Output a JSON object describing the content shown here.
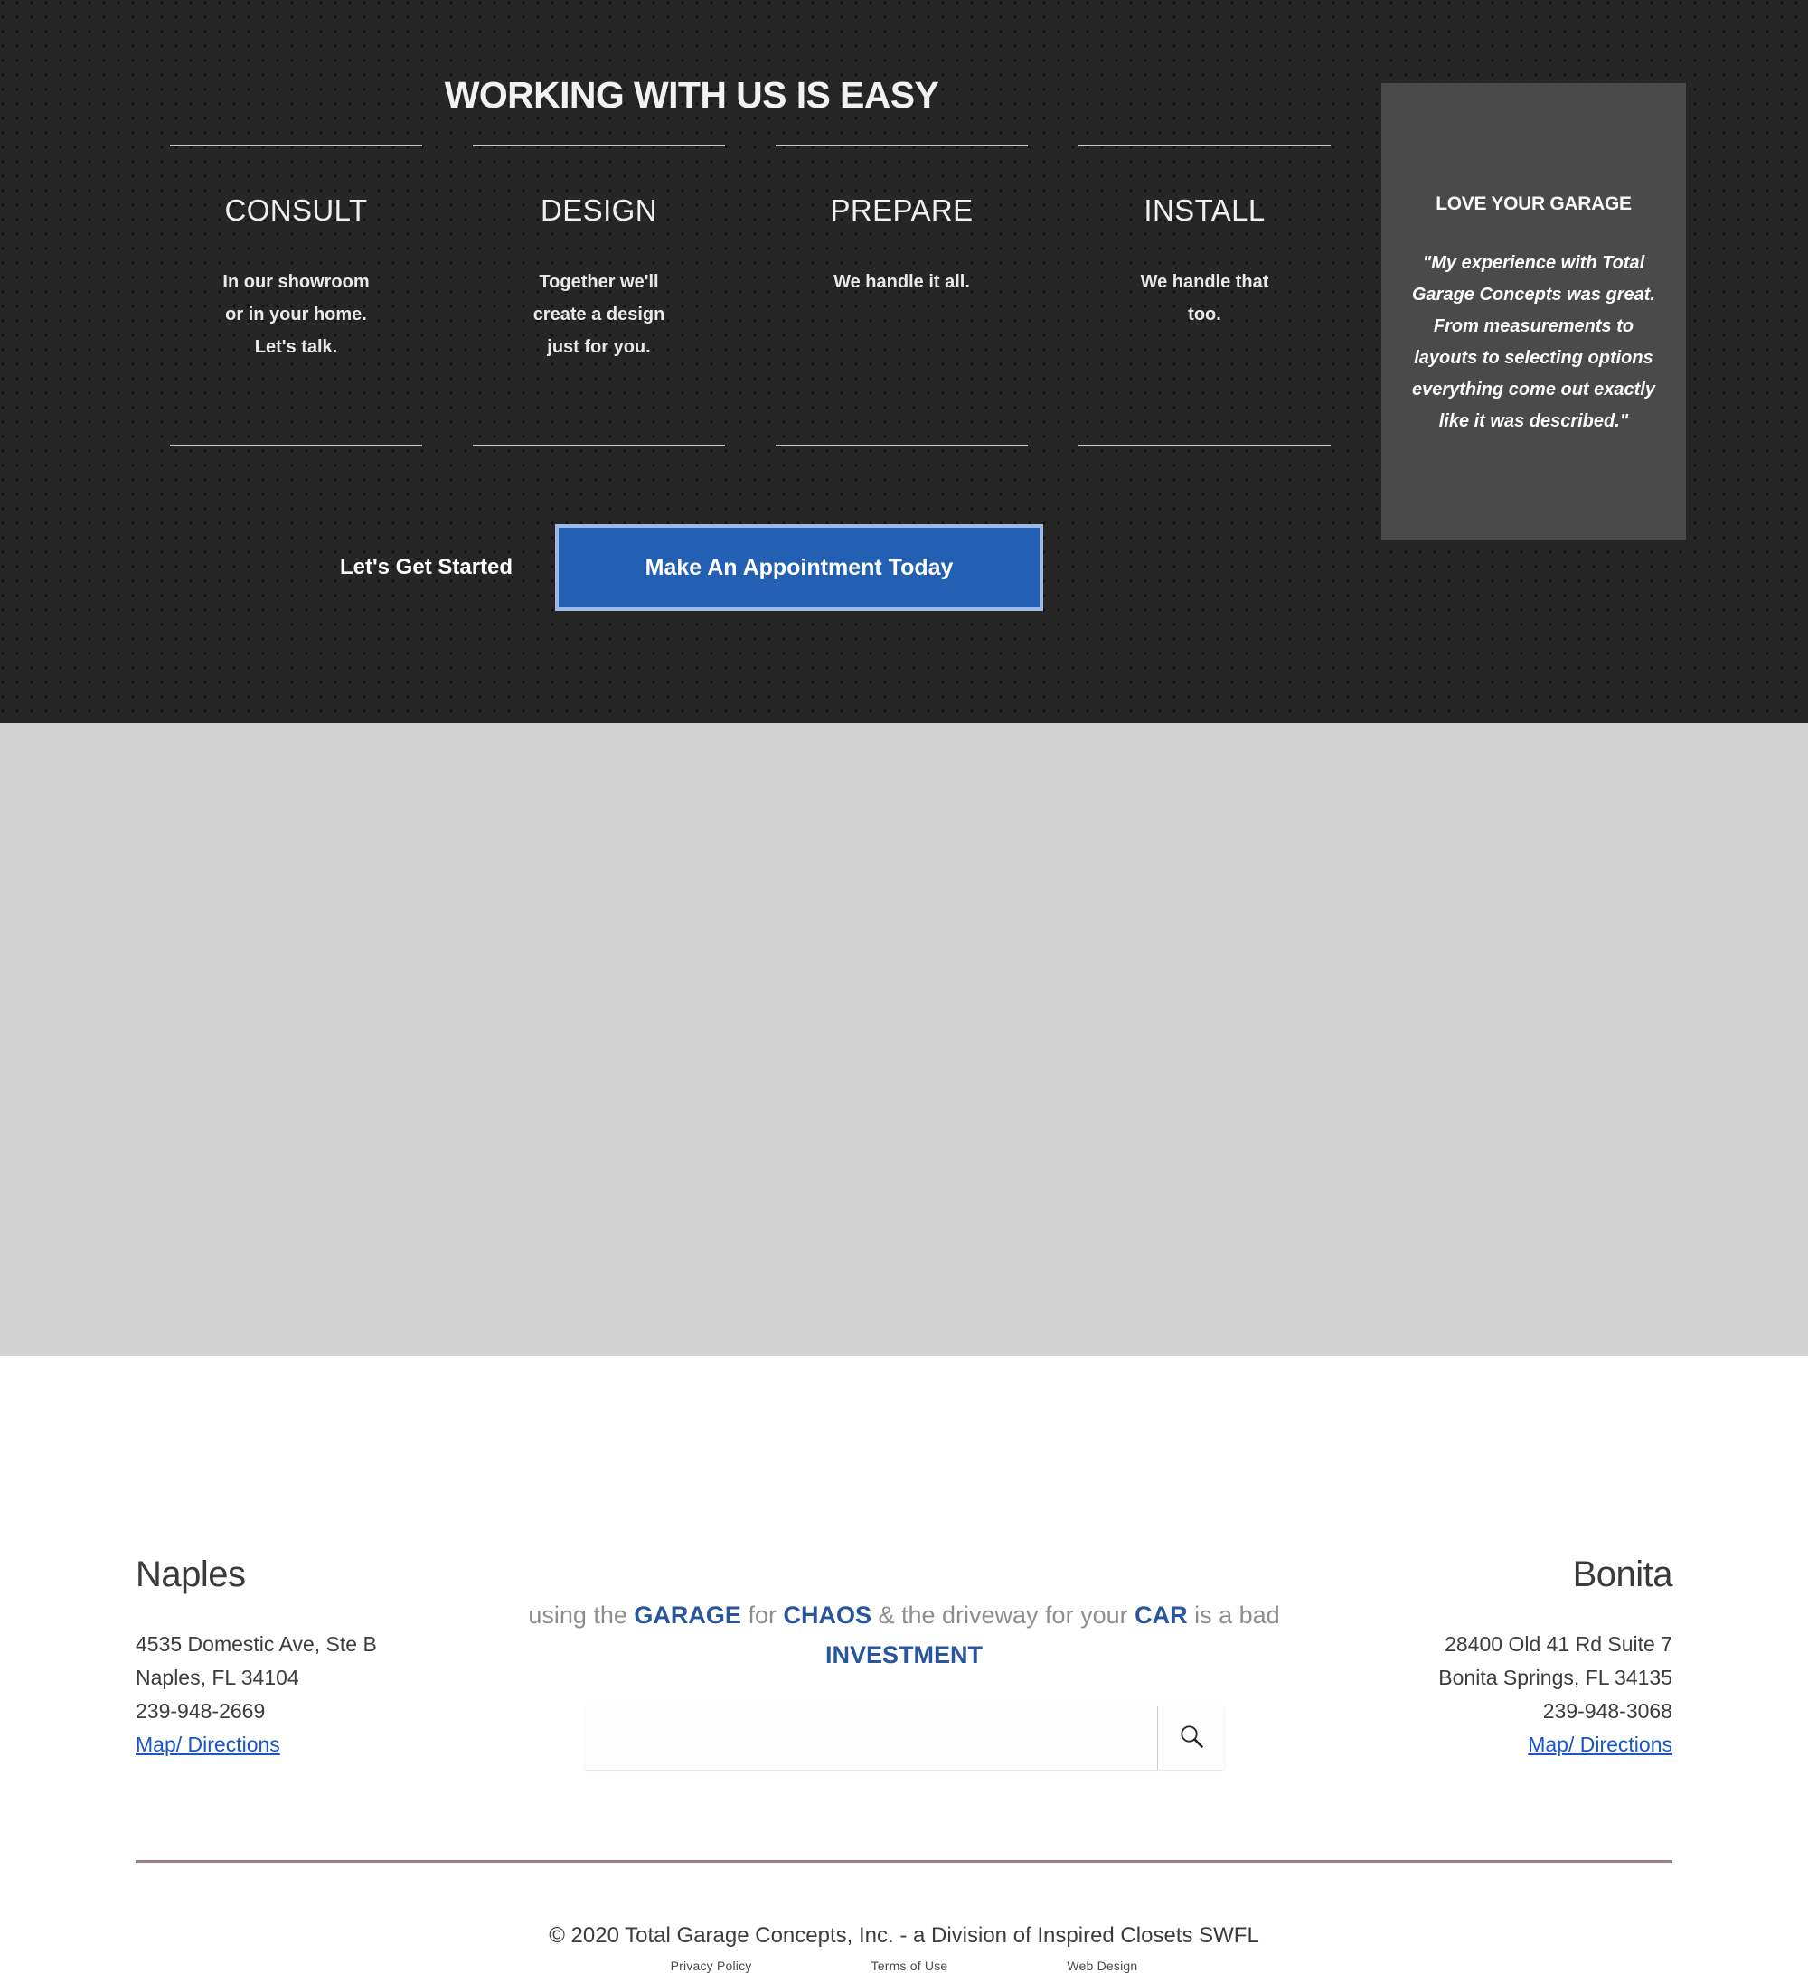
{
  "process": {
    "title": "WORKING WITH US IS EASY",
    "steps": [
      {
        "title": "CONSULT",
        "line1": "In our showroom",
        "line2": "or in your home.",
        "line3": "Let's talk."
      },
      {
        "title": "DESIGN",
        "line1": "Together we'll",
        "line2": "create a design",
        "line3": "just for you."
      },
      {
        "title": "PREPARE",
        "line1": "We handle it all.",
        "line2": "",
        "line3": ""
      },
      {
        "title": "INSTALL",
        "line1": "We handle that",
        "line2": "too.",
        "line3": ""
      }
    ],
    "testimonial": {
      "title": "LOVE YOUR GARAGE",
      "quote": "\"My experience with Total Garage Concepts was great. From measurements to layouts to selecting options everything come out exactly like it was described.\""
    },
    "cta": {
      "lead": "Let's Get Started",
      "button": "Make An Appointment Today"
    },
    "colors": {
      "background": "#262626",
      "testimonial_panel": "#4a4a4a",
      "button_fill": "#2360b4",
      "button_border": "#9dbbe2"
    }
  },
  "footer": {
    "naples": {
      "name": "Naples",
      "address1": "4535 Domestic Ave, Ste B",
      "address2": "Naples, FL 34104",
      "phone": "239-948-2669",
      "map_link": "Map/ Directions"
    },
    "bonita": {
      "name": "Bonita",
      "address1": "28400 Old 41 Rd Suite 7",
      "address2": "Bonita Springs, FL 34135",
      "phone": "239-948-3068",
      "map_link": "Map/ Directions"
    },
    "tagline": {
      "t1": "using the ",
      "b1": "GARAGE",
      "t2": " for ",
      "b2": "CHAOS",
      "t3": " & the driveway for your ",
      "b3": "CAR",
      "t4": " is a bad ",
      "b4": "INVESTMENT"
    },
    "search": {
      "value": "",
      "placeholder": "",
      "icon": "search-icon"
    },
    "copyright": "© 2020 Total Garage Concepts, Inc. - a Division of Inspired Closets SWFL",
    "links": [
      {
        "label": "Privacy Policy"
      },
      {
        "label": "Terms of Use"
      },
      {
        "label": "Web Design"
      }
    ],
    "colors": {
      "background": "#d2d2d2",
      "divider": "#9e7f85",
      "link": "#1a56c4",
      "accent": "#28559c"
    }
  }
}
